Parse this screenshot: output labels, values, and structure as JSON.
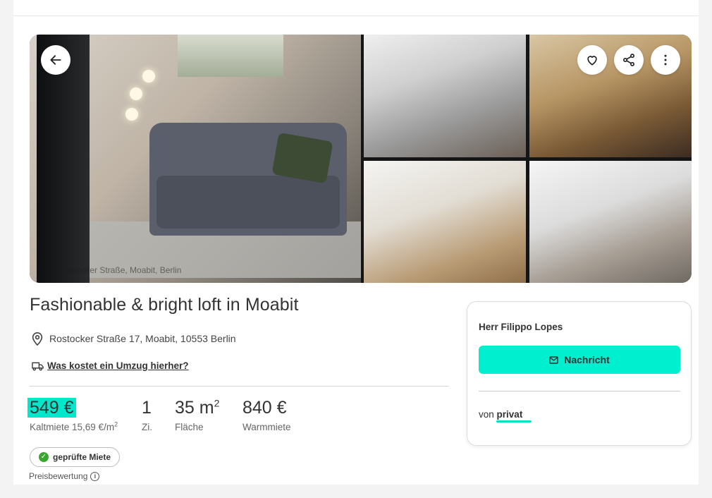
{
  "gallery": {
    "captions": [
      "Rostocker Straße, Moabit, Berlin",
      "",
      "",
      "",
      ""
    ],
    "buttons": {
      "back": "arrow-left-icon",
      "favorite": "heart-icon",
      "share": "share-icon",
      "more": "more-vertical-icon"
    }
  },
  "listing": {
    "title": "Fashionable & bright loft in Moabit",
    "address": "Rostocker Straße 17, Moabit, 10553 Berlin",
    "moving_link": "Was kostet ein Umzug hierher?",
    "stats": [
      {
        "value": "549 €",
        "label": "Kaltmiete 15,69 €/m",
        "label_sup": "2"
      },
      {
        "value": "1",
        "label": "Zi."
      },
      {
        "value": "35 m",
        "value_sup": "2",
        "label": "Fläche"
      },
      {
        "value": "840 €",
        "label": "Warmmiete"
      }
    ],
    "badge": "geprüfte Miete",
    "price_rating": "Preisbewertung"
  },
  "contact": {
    "name": "Herr Filippo Lopes",
    "message_button": "Nachricht",
    "from_prefix": "von",
    "from_value": "privat"
  },
  "colors": {
    "accent": "#00f0cf",
    "highlight": "#00e8cc",
    "check": "#3aa52f"
  }
}
